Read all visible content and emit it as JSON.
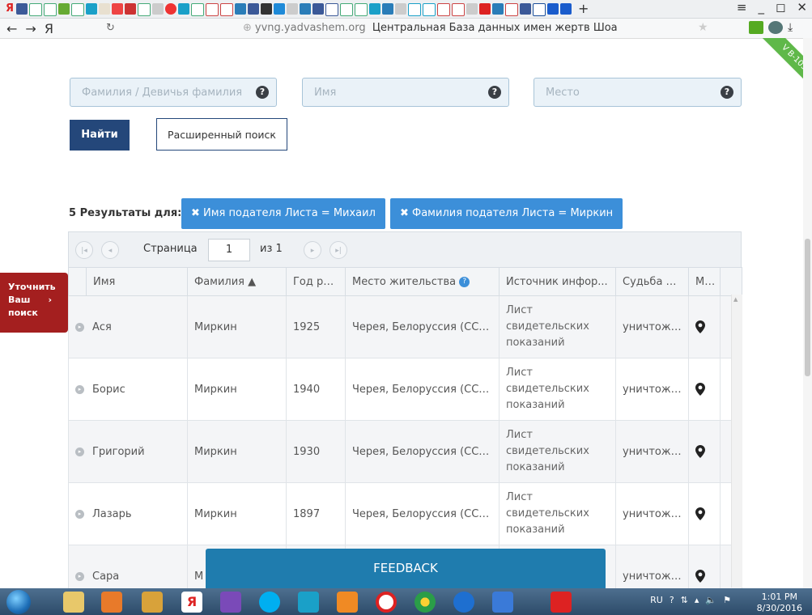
{
  "browser": {
    "back_symbol": "←",
    "forward_symbol": "→",
    "home_symbol": "Я",
    "reload_symbol": "↻",
    "url_host": "yvng.yadvashem.org",
    "page_title": "Центральная База данных имен жертв Шоа",
    "new_tab_symbol": "+",
    "window_controls": [
      "≡",
      "_",
      "◻",
      "✕"
    ]
  },
  "search": {
    "surname_placeholder": "Фамилия / Девичья фамилия",
    "name_placeholder": "Имя",
    "place_placeholder": "Место",
    "help_symbol": "?",
    "find_label": "Найти",
    "advanced_label": "Расширенный поиск"
  },
  "ribbon": {
    "label": "V B-103.1"
  },
  "results": {
    "summary": "5 Результаты для:",
    "chips": [
      {
        "label": "✖ Имя подателя Листа = Михаил"
      },
      {
        "label": "✖ Фамилия подателя Листа = Миркин"
      }
    ]
  },
  "refine": {
    "line1": "Уточнить",
    "line2": "Ваш",
    "arrow": "›",
    "line3": "поиск"
  },
  "pager": {
    "page_label": "Страница",
    "current_page": "1",
    "of_label": "из 1",
    "first": "|◂",
    "prev": "◂",
    "next": "▸",
    "last": "▸|"
  },
  "grid": {
    "columns": [
      "Имя",
      "Фамилия ▲",
      "Год ро...",
      "Место жительства",
      "Источник инфор...",
      "Судьба н...",
      "М..."
    ],
    "rows": [
      {
        "name": "Ася",
        "surname": "Миркин",
        "year": "1925",
        "place": "Черея, Белоруссия (СССР)",
        "source": "Лист свидетельских показаний",
        "fate": "уничтоже..."
      },
      {
        "name": "Борис",
        "surname": "Миркин",
        "year": "1940",
        "place": "Черея, Белоруссия (СССР)",
        "source": "Лист свидетельских показаний",
        "fate": "уничтоже..."
      },
      {
        "name": "Григорий",
        "surname": "Миркин",
        "year": "1930",
        "place": "Черея, Белоруссия (СССР)",
        "source": "Лист свидетельских показаний",
        "fate": "уничтоже..."
      },
      {
        "name": "Лазарь",
        "surname": "Миркин",
        "year": "1897",
        "place": "Черея, Белоруссия (СССР)",
        "source": "Лист свидетельских показаний",
        "fate": "уничтоже..."
      },
      {
        "name": "Сара",
        "surname": "М",
        "year": "",
        "place": "",
        "source": "",
        "fate": "уничтоже..."
      }
    ]
  },
  "feedback": {
    "label": "FEEDBACK"
  },
  "taskbar": {
    "language": "RU",
    "time": "1:01 PM",
    "date": "8/30/2016"
  },
  "colors": {
    "primary": "#24477a",
    "chip": "#3c8fd9",
    "refine": "#a41f1f",
    "feedback": "#1f7cae",
    "ribbon": "#5fb849"
  }
}
